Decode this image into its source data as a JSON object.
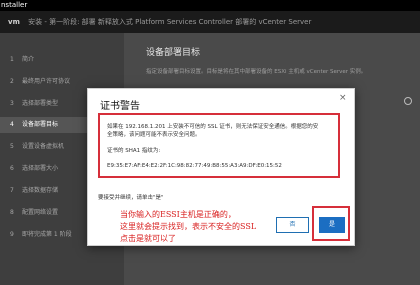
{
  "window": {
    "title": "nstaller"
  },
  "header": {
    "brand": "vm",
    "breadcrumb": "安装 - 第一阶段: 部署 新释放入式 Platform Services Controller 部署的 vCenter Server"
  },
  "sidebar": {
    "items": [
      {
        "num": "1",
        "label": "简介"
      },
      {
        "num": "2",
        "label": "最终用户许可协议"
      },
      {
        "num": "3",
        "label": "选择部署类型"
      },
      {
        "num": "4",
        "label": "设备部署目标"
      },
      {
        "num": "5",
        "label": "设置设备虚拟机"
      },
      {
        "num": "6",
        "label": "选择部署大小"
      },
      {
        "num": "7",
        "label": "选择数据存储"
      },
      {
        "num": "8",
        "label": "配置网络设置"
      },
      {
        "num": "9",
        "label": "即将完成第 1 阶段"
      }
    ]
  },
  "main": {
    "title": "设备部署目标",
    "description": "指定设备部署目标设置。目标是将在其中部署设备的 ESXi 主机或 vCenter Server 实例。"
  },
  "modal": {
    "title": "证书警告",
    "close": "×",
    "warning_lines": [
      "如果在 192.168.1.201 上安装不可信的 SSL 证书，则无法保证安全通信。根据您的安",
      "全策略，该问题可能不表示安全问题。",
      "证书的 SHA1 指纹为:",
      "E9:35:E7:AF:E4:E2:2F:1C:98:82:77:49:B8:55:A3:A9:DF:E0:15:52"
    ],
    "prompt": "要接受并继续，请单击\"是\"",
    "no_label": "否",
    "yes_label": "是"
  },
  "annotation": {
    "lines": [
      "当你输入的ESSI主机是正确的，",
      "这里就会提示找到，表示不安全的SSL",
      "点击是就可以了"
    ]
  }
}
